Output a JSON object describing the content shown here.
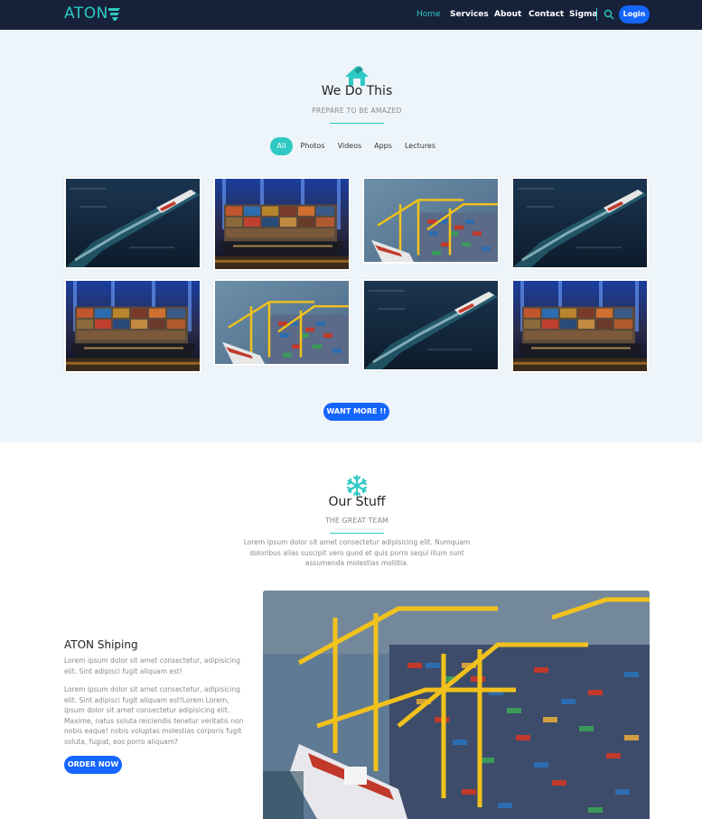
{
  "brand": {
    "name": "ATON",
    "accent": "#2ec9c4",
    "primary": "#1565ff",
    "nav_bg": "#17223a",
    "section_bg": "#eef5fa"
  },
  "nav": {
    "items": [
      {
        "label": "Home",
        "active": true
      },
      {
        "label": "Services",
        "active": false
      },
      {
        "label": "About",
        "active": false
      },
      {
        "label": "Contact",
        "active": false
      },
      {
        "label": "Sigma",
        "active": false
      }
    ],
    "search_icon": "search-icon",
    "login_label": "Login"
  },
  "portfolio": {
    "icon": "house-icon",
    "title": "We Do This",
    "subtitle": "PREPARE TO BE AMAZED",
    "filters": [
      "All",
      "Photos",
      "Videos",
      "Apps",
      "Lectures"
    ],
    "active_filter": "All",
    "images": [
      "ship-wake",
      "cargo-ship-containers",
      "port-cranes",
      "ship-wake",
      "cargo-ship-containers",
      "port-cranes",
      "ship-wake",
      "cargo-ship-containers"
    ],
    "cta_label": "WANT MORE !!"
  },
  "stuff": {
    "icon": "snowflake-icon",
    "title": "Our Stuff",
    "subtitle": "THE GREAT TEAM",
    "intro": "Lorem ipsum dolor sit amet consectetur adipisicing elit. Numquam doloribus alias suscipit vero quod et quis porro sequi illum sunt assumenda molestias mollitia.",
    "card_title": "ATON Shiping",
    "card_p1": "Lorem ipsum dolor sit amet consectetur, adipisicing elit. Sint adipisci fugit aliquam est!",
    "card_p2": "Lorem ipsum dolor sit amet consectetur, adipisicing elit. Sint adipisci fugit aliquam est!Lorem Lorem, ipsum dolor sit amet consectetur adipisicing elit. Maxime, natus soluta reiciendis tenetur veritatis non nobis eaque! nobis voluptas molestias corporis fugit soluta, fugiat, eos porro aliquam?",
    "order_label": "ORDER NOW"
  }
}
